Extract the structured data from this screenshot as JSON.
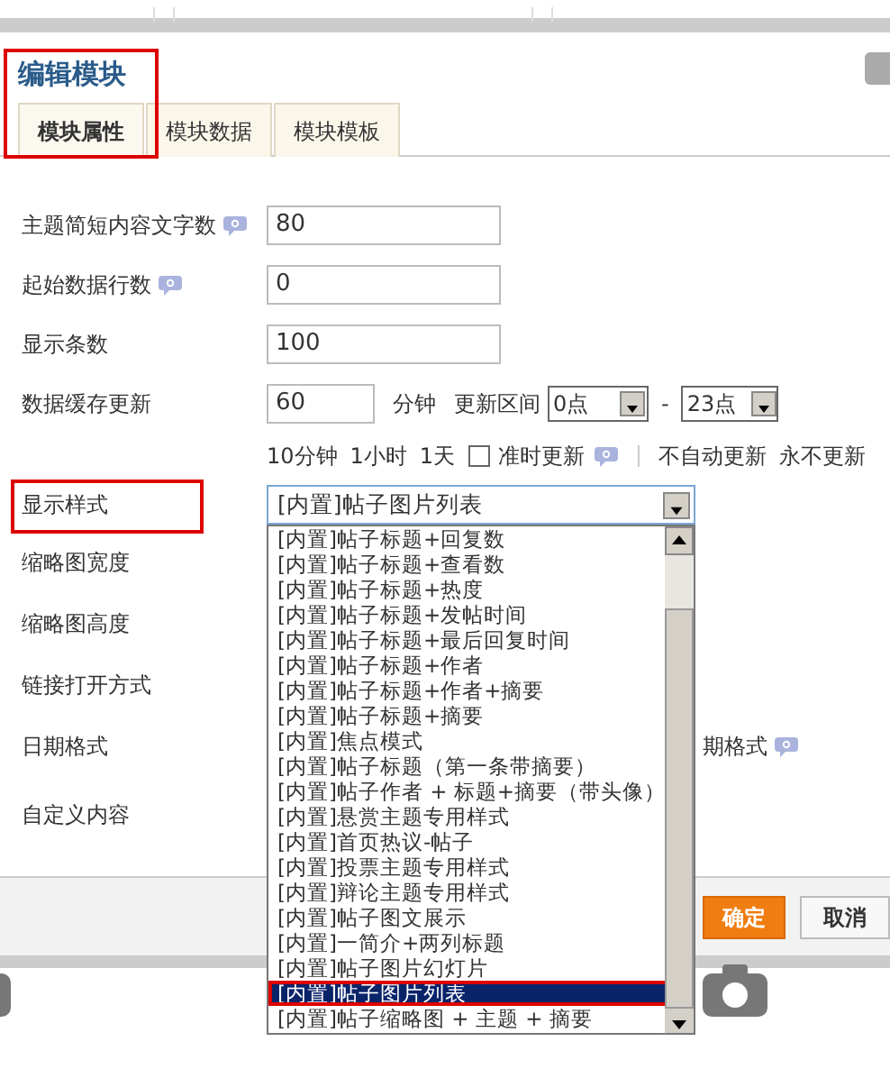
{
  "dialog": {
    "title": "编辑模块",
    "highlighted": true
  },
  "tabs": [
    {
      "label": "模块属性",
      "selected": true
    },
    {
      "label": "模块数据",
      "selected": false
    },
    {
      "label": "模块模板",
      "selected": false
    }
  ],
  "fields": [
    {
      "kind": "input",
      "label": "主题简短内容文字数",
      "help": true,
      "value": "80"
    },
    {
      "kind": "input",
      "label": "起始数据行数",
      "help": true,
      "value": "0"
    },
    {
      "kind": "input",
      "label": "显示条数",
      "help": false,
      "value": "100"
    },
    {
      "kind": "cache",
      "label": "数据缓存更新",
      "help": false,
      "value": "60",
      "unit": "分钟",
      "range_label": "更新区间",
      "from": "0点",
      "separator": "-",
      "to": "23点"
    }
  ],
  "quick_options": {
    "links": [
      "10分钟",
      "1小时",
      "1天"
    ],
    "checkbox": {
      "label": "准时更新",
      "checked": false,
      "help": true
    },
    "links_after": [
      "不自动更新",
      "永不更新"
    ]
  },
  "style_select": {
    "label": "显示样式",
    "highlighted": true,
    "value": "[内置]帖子图片列表",
    "expanded": true,
    "options": [
      {
        "label": "[内置]帖子标题+回复数",
        "selected": false
      },
      {
        "label": "[内置]帖子标题+查看数",
        "selected": false
      },
      {
        "label": "[内置]帖子标题+热度",
        "selected": false
      },
      {
        "label": "[内置]帖子标题+发帖时间",
        "selected": false
      },
      {
        "label": "[内置]帖子标题+最后回复时间",
        "selected": false
      },
      {
        "label": "[内置]帖子标题+作者",
        "selected": false
      },
      {
        "label": "[内置]帖子标题+作者+摘要",
        "selected": false
      },
      {
        "label": "[内置]帖子标题+摘要",
        "selected": false
      },
      {
        "label": "[内置]焦点模式",
        "selected": false
      },
      {
        "label": "[内置]帖子标题（第一条带摘要）",
        "selected": false
      },
      {
        "label": "[内置]帖子作者 + 标题+摘要（带头像）",
        "selected": false
      },
      {
        "label": "[内置]悬赏主题专用样式",
        "selected": false
      },
      {
        "label": "[内置]首页热议-帖子",
        "selected": false
      },
      {
        "label": "[内置]投票主题专用样式",
        "selected": false
      },
      {
        "label": "[内置]辩论主题专用样式",
        "selected": false
      },
      {
        "label": "[内置]帖子图文展示",
        "selected": false
      },
      {
        "label": "[内置]一简介+两列标题",
        "selected": false
      },
      {
        "label": "[内置]帖子图片幻灯片",
        "selected": false
      },
      {
        "label": "[内置]帖子图片列表",
        "selected": true
      },
      {
        "label": "[内置]帖子缩略图 + 主题 + 摘要",
        "selected": false
      }
    ]
  },
  "more_fields": [
    "缩略图宽度",
    "缩略图高度",
    "链接打开方式",
    "日期格式",
    "自定义内容"
  ],
  "partial_label": {
    "text": "期格式",
    "help": true
  },
  "buttons": [
    {
      "label": "确定",
      "kind": "primary"
    },
    {
      "label": "取消",
      "kind": "secondary"
    }
  ]
}
